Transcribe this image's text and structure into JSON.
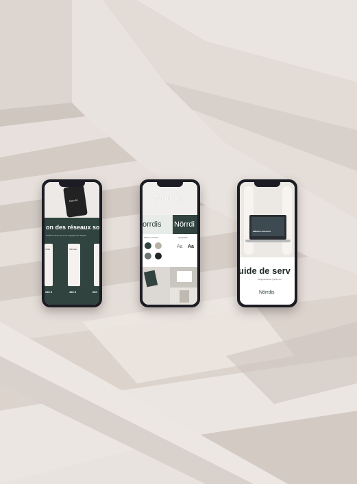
{
  "phone_left": {
    "brand": "Nörrdis",
    "headline": "on des réseaux so",
    "subline": "Profitez mieux pour vos engagement auprès",
    "plans": [
      "Initial",
      "Ultimate",
      ""
    ],
    "prices": [
      "250 $",
      "450 $",
      "650"
    ]
  },
  "phone_middle": {
    "brand": "Nörrdis",
    "logo_light": "orrdis",
    "logo_dark": "Nörrdi",
    "palette_label": "Palette de couleurs",
    "type_label": "Typographie",
    "type_sample_light": "Aa",
    "type_sample_bold": "Aa"
  },
  "phone_right": {
    "laptop_caption": "MÉDIAS SOCIAUX",
    "headline": "uide de serv",
    "contact": "info@nordis.ca | (225) xxx",
    "brand": "Nörrdis"
  },
  "colors": {
    "wall": "#e9e3df",
    "stair_shadow": "#d7cec8",
    "brand_dark": "#30433f",
    "phone_frame": "#1c1c24"
  }
}
